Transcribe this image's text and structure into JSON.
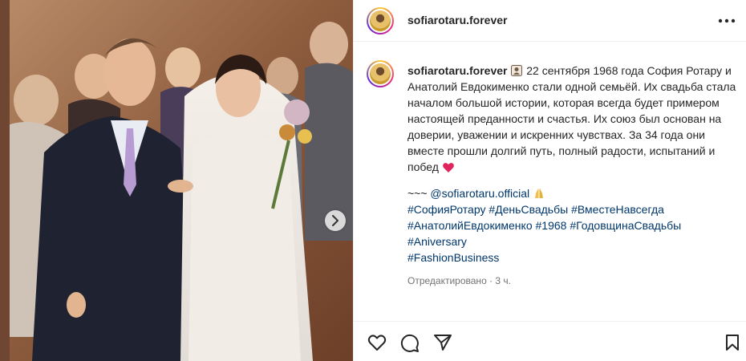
{
  "post": {
    "username": "sofiarotaru.forever",
    "more_icon": "more-horizontal-icon"
  },
  "caption": {
    "username": "sofiarotaru.forever",
    "text": "22 сентября 1968 года София Ротару и Анатолий Евдокименко стали одной семьёй. Их свадьба стала началом большой истории, которая всегда будет примером настоящей преданности и счастья. Их союз был основан на доверии, уважении и искренних чувствах. За 34 года они вместе прошли долгий путь, полный радости, испытаний и побед",
    "tilde": "~~~",
    "mention": "@sofiarotaru.official",
    "hashtags": [
      "#СофияРотару",
      "#ДеньСвадьбы",
      "#ВместеНавсегда",
      "#АнатолийЕвдокименко",
      "#1968",
      "#ГодовщинаСвадьбы",
      "#Aniversary",
      "#FashionBusiness"
    ],
    "meta": "Отредактировано · 3 ч."
  },
  "colors": {
    "link": "#00376b",
    "heart": "#e0245e",
    "muted": "#737373",
    "border": "#efefef"
  }
}
